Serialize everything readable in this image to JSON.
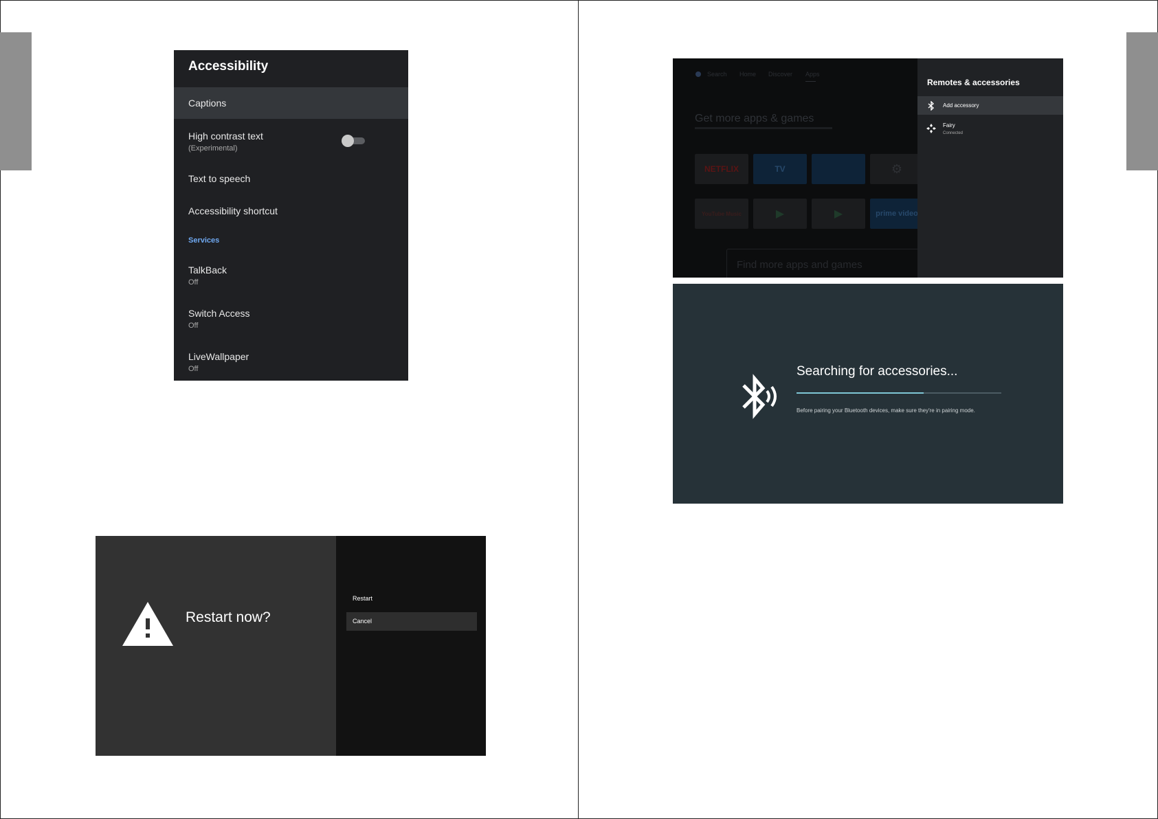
{
  "accessibility": {
    "title": "Accessibility",
    "items": [
      {
        "label": "Captions"
      },
      {
        "label": "High contrast text",
        "sub": "(Experimental)",
        "toggle_on": false
      },
      {
        "label": "Text to speech"
      },
      {
        "label": "Accessibility shortcut"
      }
    ],
    "section": "Services",
    "services": [
      {
        "label": "TalkBack",
        "sub": "Off"
      },
      {
        "label": "Switch Access",
        "sub": "Off"
      },
      {
        "label": "LiveWallpaper",
        "sub": "Off"
      }
    ]
  },
  "restart_dialog": {
    "title": "Restart now?",
    "options": [
      "Restart",
      "Cancel"
    ],
    "selected": "Cancel"
  },
  "home": {
    "nav": [
      "Search",
      "Home",
      "Discover",
      "Apps"
    ],
    "heading": "Get more apps & games",
    "find_text": "Find more apps and games",
    "tiles_row1": [
      "NETFLIX",
      "TV",
      "",
      ""
    ],
    "tiles_row2": [
      "YouTube Music",
      "",
      "",
      "prime video"
    ]
  },
  "remotes": {
    "title": "Remotes & accessories",
    "add_label": "Add accessory",
    "device_name": "Fairy",
    "device_status": "Connected"
  },
  "searching": {
    "title": "Searching for accessories...",
    "note": "Before pairing your Bluetooth devices, make sure they're in pairing mode.",
    "progress": 0.62
  },
  "colors": {
    "accent_blue": "#6fa8f0",
    "progress_teal": "#7fc7d6"
  }
}
